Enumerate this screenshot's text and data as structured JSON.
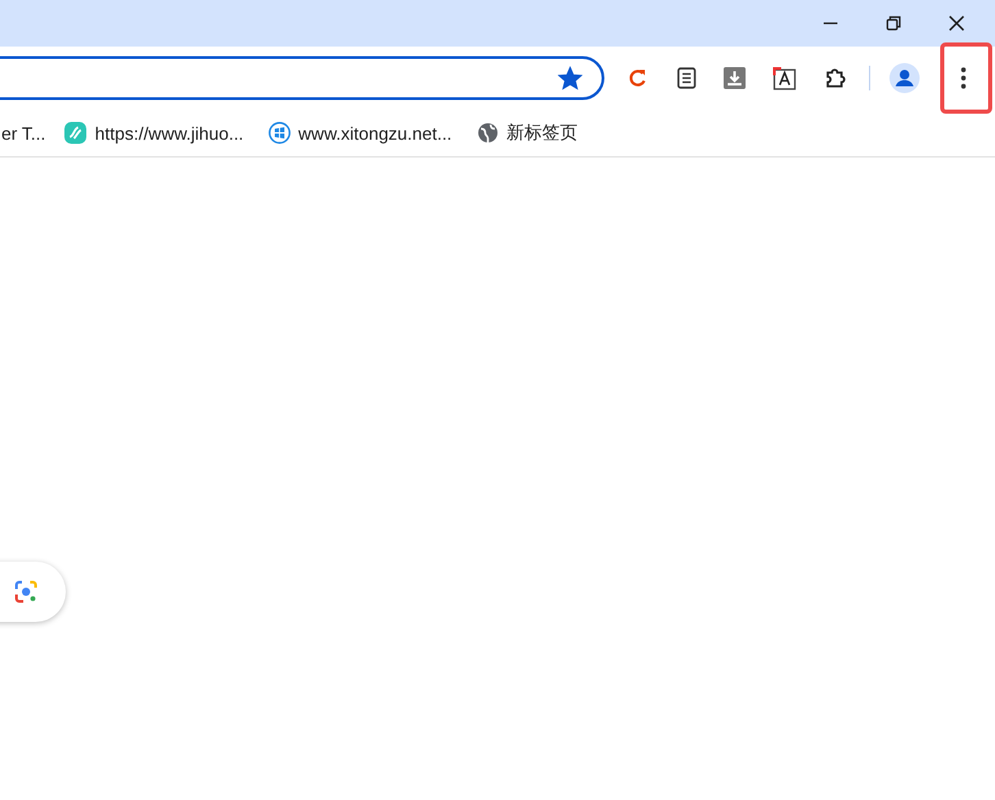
{
  "window": {
    "controls": [
      {
        "kind": "minimize"
      },
      {
        "kind": "restore"
      },
      {
        "kind": "close"
      }
    ]
  },
  "address_bar": {
    "starred": true
  },
  "toolbar": {
    "items": [
      {
        "kind": "reload"
      },
      {
        "kind": "document"
      },
      {
        "kind": "download"
      },
      {
        "kind": "font"
      },
      {
        "kind": "extensions"
      },
      {
        "kind": "divider"
      },
      {
        "kind": "profile"
      },
      {
        "kind": "menu",
        "highlighted": true
      }
    ]
  },
  "bookmarks": [
    {
      "label": "er T...",
      "kind": "none"
    },
    {
      "label": "https://www.jihuo...",
      "kind": "jihuo"
    },
    {
      "label": "www.xitongzu.net...",
      "kind": "windows"
    },
    {
      "label": "新标签页",
      "kind": "globe"
    }
  ],
  "lens_button": {
    "kind": "lens"
  }
}
